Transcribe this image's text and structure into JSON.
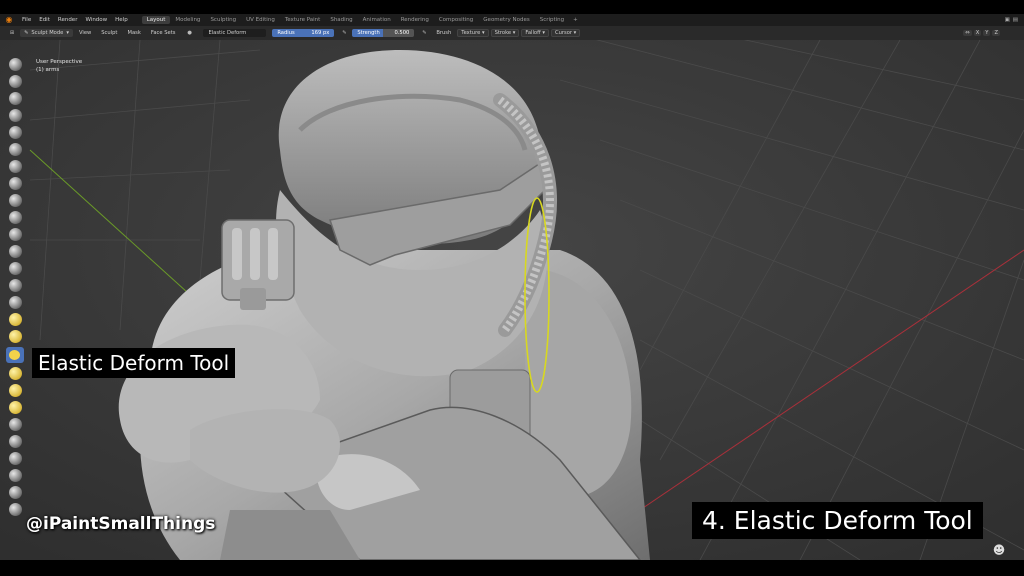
{
  "menubar": {
    "items": [
      "File",
      "Edit",
      "Render",
      "Window",
      "Help"
    ],
    "workspaces": [
      {
        "label": "Layout",
        "active": true
      },
      {
        "label": "Modeling",
        "active": false
      },
      {
        "label": "Sculpting",
        "active": false
      },
      {
        "label": "UV Editing",
        "active": false
      },
      {
        "label": "Texture Paint",
        "active": false
      },
      {
        "label": "Shading",
        "active": false
      },
      {
        "label": "Animation",
        "active": false
      },
      {
        "label": "Rendering",
        "active": false
      },
      {
        "label": "Compositing",
        "active": false
      },
      {
        "label": "Geometry Nodes",
        "active": false
      },
      {
        "label": "Scripting",
        "active": false
      }
    ],
    "add_tab": "+"
  },
  "header": {
    "mode": "Sculpt Mode",
    "menus": [
      "View",
      "Sculpt",
      "Mask",
      "Face Sets"
    ],
    "tool_name": "Elastic Deform",
    "radius_label": "Radius",
    "radius_value": "169 px",
    "strength_label": "Strength",
    "strength_value": "0.500",
    "brush": "Brush",
    "texture": "Texture",
    "stroke": "Stroke",
    "falloff": "Falloff",
    "cursor": "Cursor",
    "axes": [
      "X",
      "Y",
      "Z"
    ]
  },
  "viewport": {
    "perspective": "User Perspective",
    "object": "(1) arms"
  },
  "captions": {
    "tool_overlay": "Elastic Deform Tool",
    "handle": "@iPaintSmallThings",
    "numbered": "4. Elastic Deform Tool"
  },
  "colors": {
    "accent": "#4a72b8",
    "brush_ring": "#d8d820",
    "grid_x_axis": "#a8303a",
    "grid_y_axis": "#6a9a28"
  },
  "icons": [
    "blender-logo-icon",
    "sculpt-brush-icon",
    "gizmo-icon",
    "creator-badge-icon"
  ]
}
